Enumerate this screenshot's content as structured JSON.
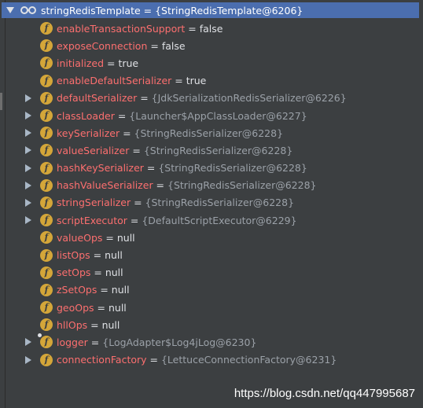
{
  "root": {
    "name": "stringRedisTemplate",
    "eq": " = ",
    "value": "{StringRedisTemplate@6206}",
    "icon": "watch-glasses-icon"
  },
  "fields": [
    {
      "name": "enableTransactionSupport",
      "value": "false",
      "kind": "plain",
      "expandable": false,
      "badge": false
    },
    {
      "name": "exposeConnection",
      "value": "false",
      "kind": "plain",
      "expandable": false,
      "badge": false
    },
    {
      "name": "initialized",
      "value": "true",
      "kind": "plain",
      "expandable": false,
      "badge": false
    },
    {
      "name": "enableDefaultSerializer",
      "value": "true",
      "kind": "plain",
      "expandable": false,
      "badge": false
    },
    {
      "name": "defaultSerializer",
      "value": "{JdkSerializationRedisSerializer@6226}",
      "kind": "obj",
      "expandable": true,
      "badge": false
    },
    {
      "name": "classLoader",
      "value": "{Launcher$AppClassLoader@6227}",
      "kind": "obj",
      "expandable": true,
      "badge": false
    },
    {
      "name": "keySerializer",
      "value": "{StringRedisSerializer@6228}",
      "kind": "obj",
      "expandable": true,
      "badge": false
    },
    {
      "name": "valueSerializer",
      "value": "{StringRedisSerializer@6228}",
      "kind": "obj",
      "expandable": true,
      "badge": false
    },
    {
      "name": "hashKeySerializer",
      "value": "{StringRedisSerializer@6228}",
      "kind": "obj",
      "expandable": true,
      "badge": false
    },
    {
      "name": "hashValueSerializer",
      "value": "{StringRedisSerializer@6228}",
      "kind": "obj",
      "expandable": true,
      "badge": false
    },
    {
      "name": "stringSerializer",
      "value": "{StringRedisSerializer@6228}",
      "kind": "obj",
      "expandable": true,
      "badge": false
    },
    {
      "name": "scriptExecutor",
      "value": "{DefaultScriptExecutor@6229}",
      "kind": "obj",
      "expandable": true,
      "badge": false
    },
    {
      "name": "valueOps",
      "value": "null",
      "kind": "plain",
      "expandable": false,
      "badge": false
    },
    {
      "name": "listOps",
      "value": "null",
      "kind": "plain",
      "expandable": false,
      "badge": false
    },
    {
      "name": "setOps",
      "value": "null",
      "kind": "plain",
      "expandable": false,
      "badge": false
    },
    {
      "name": "zSetOps",
      "value": "null",
      "kind": "plain",
      "expandable": false,
      "badge": false
    },
    {
      "name": "geoOps",
      "value": "null",
      "kind": "plain",
      "expandable": false,
      "badge": false
    },
    {
      "name": "hllOps",
      "value": "null",
      "kind": "plain",
      "expandable": false,
      "badge": false
    },
    {
      "name": "logger",
      "value": "{LogAdapter$Log4jLog@6230}",
      "kind": "obj",
      "expandable": true,
      "badge": true
    },
    {
      "name": "connectionFactory",
      "value": "{LettuceConnectionFactory@6231}",
      "kind": "obj",
      "expandable": true,
      "badge": false
    }
  ],
  "eq": " = ",
  "field_icon_letter": "f",
  "field_icon_name": "field-icon",
  "watermark": "https://blog.csdn.net/qq447995687",
  "colors": {
    "background": "#3c3f41",
    "selection": "#4b6eaf",
    "field_name": "#fc6f6f",
    "field_icon": "#d4a639",
    "object_value": "#9ba1a8",
    "plain_value": "#dfe1e5"
  }
}
